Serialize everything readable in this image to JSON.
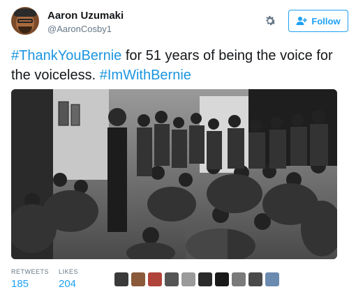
{
  "user": {
    "name": "Aaron Uzumaki",
    "handle": "@AaronCosby1"
  },
  "actions": {
    "follow_label": "Follow",
    "settings_icon": "gear-icon",
    "follow_icon": "add-user-icon"
  },
  "tweet": {
    "hashtag1": "#ThankYouBernie",
    "text_mid": " for 51 years of being the voice for the voiceless. ",
    "hashtag2": "#ImWithBernie"
  },
  "photo": {
    "icon": "black-and-white-photo"
  },
  "stats": {
    "retweets_label": "RETWEETS",
    "retweets_value": "185",
    "likes_label": "LIKES",
    "likes_value": "204"
  },
  "likers": [
    {
      "color": "#3a3a3a"
    },
    {
      "color": "#8a5a3a"
    },
    {
      "color": "#b0433a"
    },
    {
      "color": "#555555"
    },
    {
      "color": "#9a9a9a"
    },
    {
      "color": "#2a2a2a"
    },
    {
      "color": "#1a1a1a"
    },
    {
      "color": "#7a7a7a"
    },
    {
      "color": "#4a4a4a"
    },
    {
      "color": "#6a8ab0"
    }
  ],
  "colors": {
    "accent": "#1da1f2",
    "hashtag": "#1b95e0",
    "muted": "#657786"
  }
}
